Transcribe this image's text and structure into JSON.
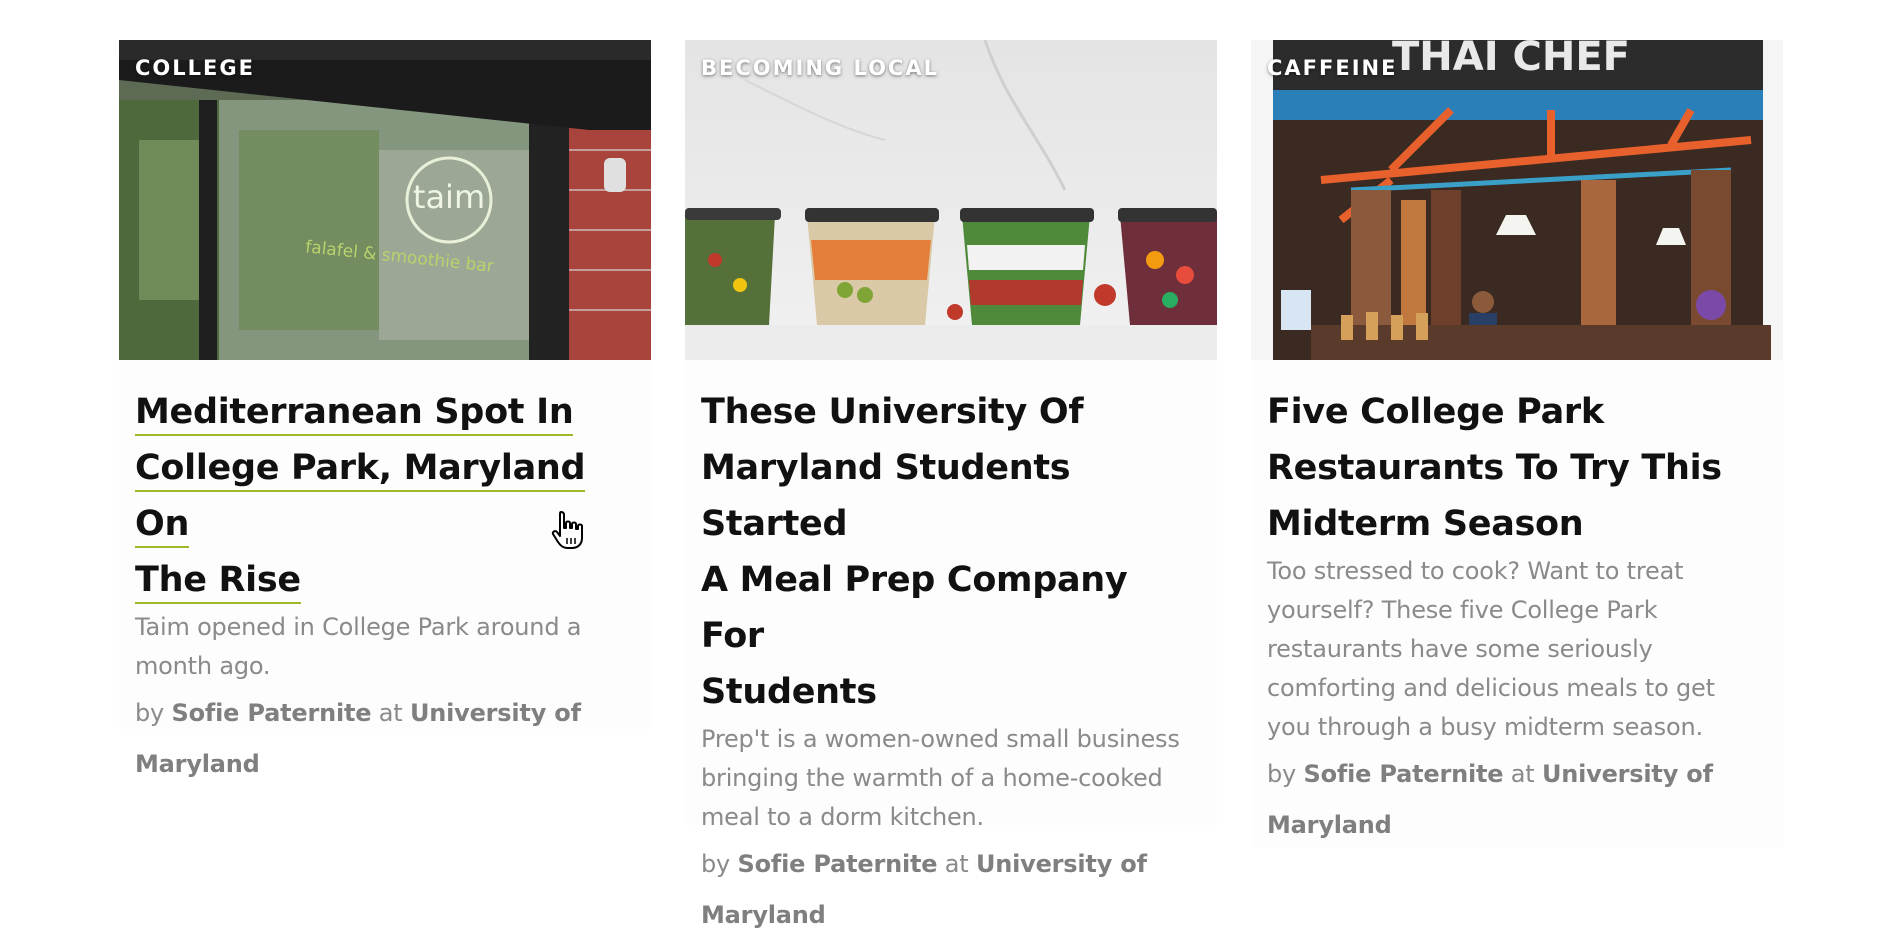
{
  "cards": [
    {
      "category": "COLLEGE",
      "title_lines": [
        "Mediterranean Spot In",
        "College Park, Maryland On",
        "The Rise"
      ],
      "excerpt_lines": [
        "Taim opened in College Park around a",
        "month ago."
      ],
      "byline": {
        "by": "by",
        "author": "Sofie Paternite",
        "at": "at",
        "school_line1": "University of",
        "school_line2": "Maryland"
      },
      "image": {
        "sign_text": "taim",
        "sign_subtext": "falafel & smoothie bar"
      }
    },
    {
      "category": "BECOMING LOCAL",
      "title_lines": [
        "These University Of",
        "Maryland Students Started",
        "A Meal Prep Company For",
        "Students"
      ],
      "excerpt_lines": [
        "Prep't is a women-owned small business",
        "bringing the warmth of a home-cooked",
        "meal to a dorm kitchen."
      ],
      "byline": {
        "by": "by",
        "author": "Sofie Paternite",
        "at": "at",
        "school_line1": "University of",
        "school_line2": "Maryland"
      }
    },
    {
      "category": "CAFFEINE",
      "title_lines": [
        "Five College Park",
        "Restaurants To Try This",
        "Midterm Season"
      ],
      "excerpt_lines": [
        "Too stressed to cook? Want to treat",
        "yourself? These five College Park",
        "restaurants have some seriously",
        "comforting and delicious meals to get",
        "you through a busy midterm season."
      ],
      "byline": {
        "by": "by",
        "author": "Sofie Paternite",
        "at": "at",
        "school_line1": "University of",
        "school_line2": "Maryland"
      },
      "image": {
        "sign_text": "THAI CHEF"
      }
    }
  ],
  "colors": {
    "title": "#111111",
    "excerpt": "#8a8a8a",
    "hover_underline": "#9bbb2a"
  },
  "cursor": "hand-pointer-icon"
}
